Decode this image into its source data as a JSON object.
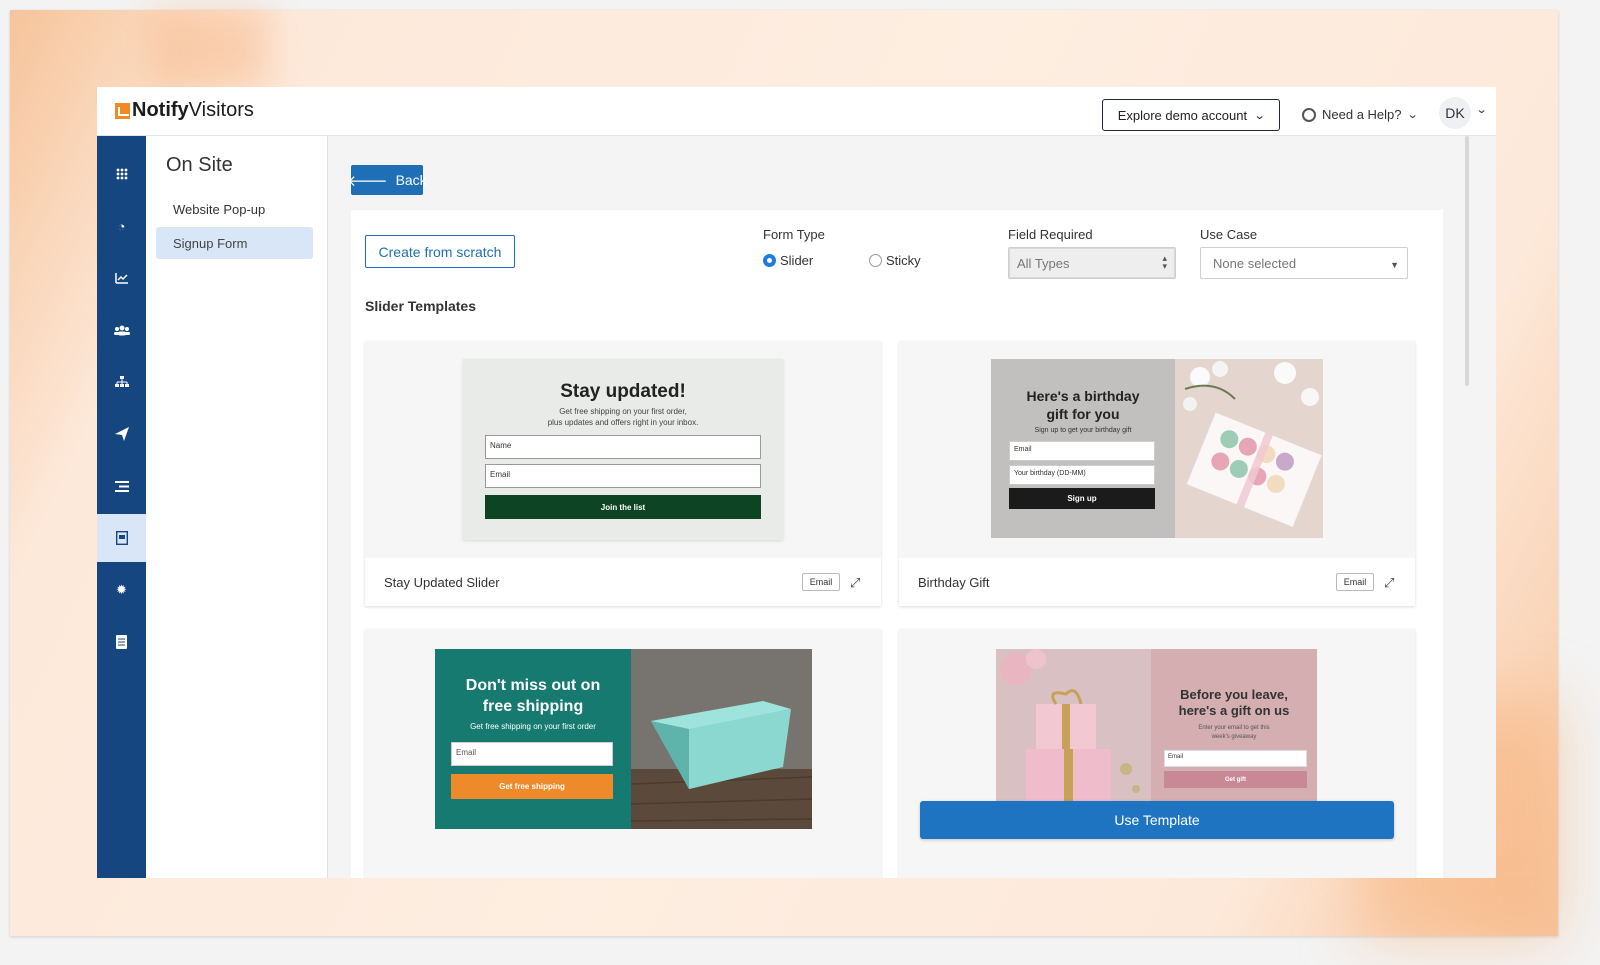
{
  "brand": {
    "name_bold": "Notify",
    "name_rest": "Visitors"
  },
  "header": {
    "explore_label": "Explore demo account",
    "help_label": "Need a Help?",
    "avatar_initials": "DK"
  },
  "sidebar": {
    "icons": [
      "apps-grid-icon",
      "dashboard-gauge-icon",
      "analytics-chart-icon",
      "users-group-icon",
      "hierarchy-icon",
      "send-plane-icon",
      "list-icon",
      "signup-form-icon",
      "settings-gear-icon",
      "document-icon"
    ],
    "active_index": 7
  },
  "subnav": {
    "title": "On Site",
    "items": [
      {
        "label": "Website Pop-up",
        "active": false
      },
      {
        "label": "Signup Form",
        "active": true
      }
    ]
  },
  "main": {
    "back_label": "Back",
    "create_label": "Create from scratch",
    "form_type": {
      "label": "Form Type",
      "options": [
        "Slider",
        "Sticky"
      ],
      "selected": "Slider"
    },
    "field_required": {
      "label": "Field Required",
      "value": "All Types"
    },
    "use_case": {
      "label": "Use Case",
      "value": "None selected"
    },
    "section_title": "Slider Templates"
  },
  "templates": [
    {
      "name": "Stay Updated Slider",
      "tag": "Email",
      "preview": {
        "heading": "Stay updated!",
        "sub1": "Get free shipping on your first order,",
        "sub2": "plus updates and offers right in your inbox.",
        "field1": "Name",
        "field2": "Email",
        "button": "Join the list"
      }
    },
    {
      "name": "Birthday Gift",
      "tag": "Email",
      "preview": {
        "heading1": "Here's a birthday",
        "heading2": "gift for you",
        "sub": "Sign up to get your birthday gift",
        "field1": "Email",
        "field2": "Your birthday (DD-MM)",
        "button": "Sign up"
      }
    },
    {
      "preview": {
        "heading1": "Don't miss out on",
        "heading2": "free shipping",
        "sub": "Get free shipping on your first order",
        "field1": "Email",
        "button": "Get free shipping"
      }
    },
    {
      "use_label": "Use Template",
      "preview": {
        "heading1": "Before you leave,",
        "heading2": "here's a gift on us",
        "sub1": "Enter your email to get this",
        "sub2": "week's giveaway",
        "field1": "Email",
        "button": "Get gift"
      }
    }
  ],
  "colors": {
    "sidebar_bg": "#16467f",
    "primary": "#1e6fb5",
    "tpl1_button": "#0d4423",
    "tpl3_bg": "#167a70",
    "tpl3_button": "#ee8a2a",
    "tpl4_button": "#c98896"
  }
}
